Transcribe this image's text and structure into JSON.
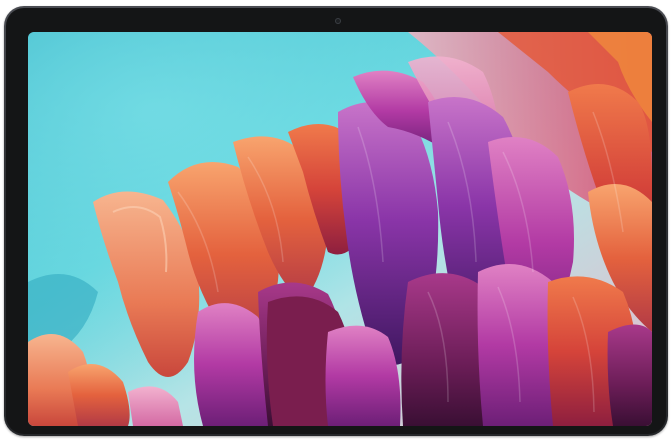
{
  "image": {
    "device": "tablet",
    "wallpaper_theme": "abstract-feather-petals",
    "colors": {
      "frame": "#2e3034",
      "bezel": "#141516",
      "sky_cyan": "#45c8d8",
      "sky_teal": "#2fb1c2",
      "peach": "#f2a07a",
      "orange": "#e2643d",
      "red": "#c63b33",
      "magenta": "#b0379f",
      "purple": "#7a2f9e",
      "deep_purple": "#4b1f6e",
      "plum": "#6e1f4a"
    }
  }
}
